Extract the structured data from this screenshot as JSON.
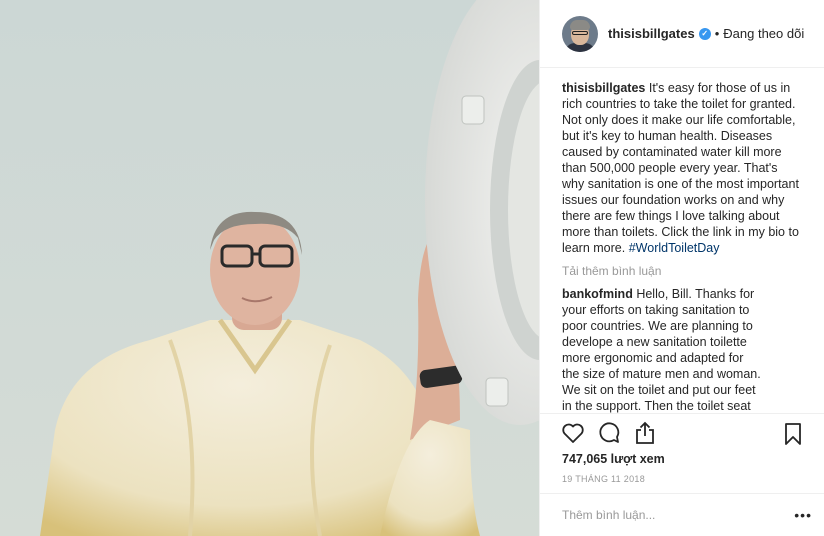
{
  "header": {
    "username": "thisisbillgates",
    "separator": "•",
    "follow_status": "Đang theo dõi"
  },
  "caption": {
    "username": "thisisbillgates",
    "text": "It's easy for those of us in rich countries to take the toilet for granted. Not only does it make our life comfortable, but it's key to human health. Diseases caused by contaminated water kill more than 500,000 people every year. That's why sanitation is one of the most important issues our foundation works on and why there are few things I love talking about more than toilets. Click the link in my bio to learn more.",
    "hashtag": "#WorldToiletDay"
  },
  "load_more": "Tải thêm bình luận",
  "comment": {
    "username": "bankofmind",
    "text": "Hello, Bill. Thanks for your efforts on taking sanitation to poor countries. We are planning to develope a new sanitation toilette more ergonomic and adapted for the size of mature men and woman. We sit on the toilet and put our feet in the support. Then the toilet seat slides"
  },
  "stats": {
    "views": "747,065 lượt xem",
    "date": "19 THÁNG 11 2018"
  },
  "add_comment": {
    "placeholder": "Thêm bình luận...",
    "more": "•••"
  },
  "icons": {
    "like": "heart-icon",
    "comment": "comment-icon",
    "share": "share-icon",
    "save": "bookmark-icon",
    "verified": "verified-badge-icon"
  },
  "colors": {
    "link": "#003569",
    "verified": "#3897f0",
    "muted": "#999999",
    "text": "#262626"
  }
}
